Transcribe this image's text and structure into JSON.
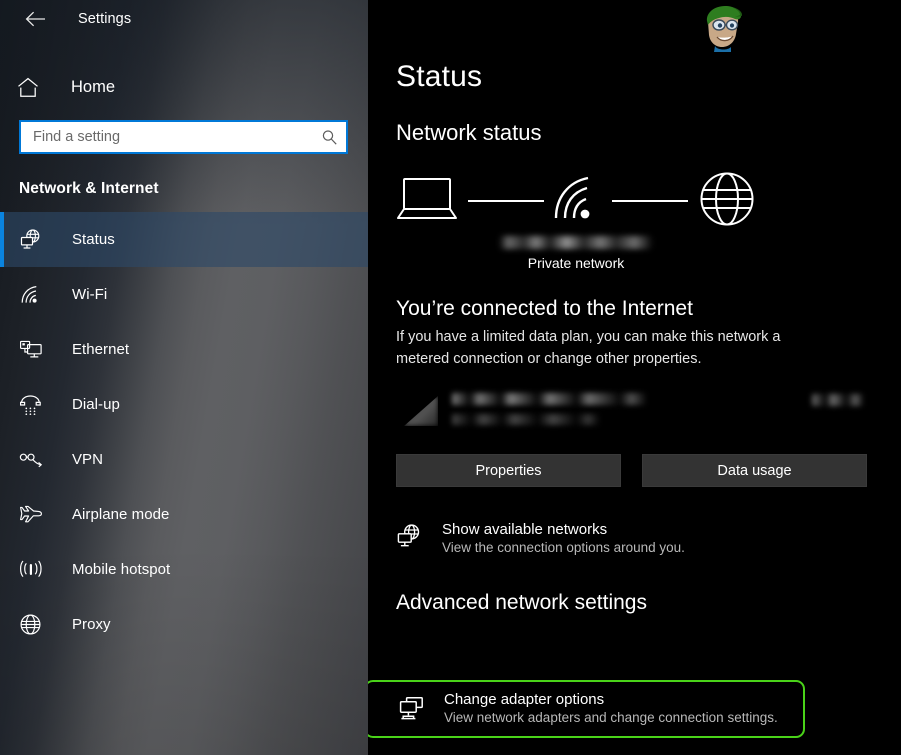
{
  "window": {
    "app_title": "Settings",
    "back_icon": "back-arrow-icon"
  },
  "sidebar": {
    "home": {
      "label": "Home",
      "icon": "home-icon"
    },
    "search": {
      "placeholder": "Find a setting",
      "value": "",
      "icon": "search-icon"
    },
    "category_heading": "Network & Internet",
    "items": [
      {
        "label": "Status",
        "icon": "network-status-icon",
        "selected": true
      },
      {
        "label": "Wi-Fi",
        "icon": "wifi-icon",
        "selected": false
      },
      {
        "label": "Ethernet",
        "icon": "ethernet-icon",
        "selected": false
      },
      {
        "label": "Dial-up",
        "icon": "dialup-phone-icon",
        "selected": false
      },
      {
        "label": "VPN",
        "icon": "vpn-icon",
        "selected": false
      },
      {
        "label": "Airplane mode",
        "icon": "airplane-icon",
        "selected": false
      },
      {
        "label": "Mobile hotspot",
        "icon": "mobile-hotspot-icon",
        "selected": false
      },
      {
        "label": "Proxy",
        "icon": "globe-proxy-icon",
        "selected": false
      }
    ],
    "accent_color": "#0a84e0",
    "selected_bg": "#2d4868"
  },
  "main": {
    "page_title": "Status",
    "network_status": {
      "section_title": "Network status",
      "diagram": {
        "device_icon": "laptop-icon",
        "link_icon": "wifi-signal-icon",
        "internet_icon": "globe-icon",
        "ssid_label": "",
        "ssid_redacted": true,
        "network_kind": "Private network"
      },
      "connected_heading": "You’re connected to the Internet",
      "connected_description": "If you have a limited data plan, you can make this network a metered connection or change other properties.",
      "usage_row": {
        "redacted": true,
        "network_name": "",
        "period_label": "",
        "data_size": ""
      },
      "buttons": [
        {
          "label": "Properties"
        },
        {
          "label": "Data usage"
        }
      ],
      "show_networks": {
        "icon": "network-status-icon",
        "title": "Show available networks",
        "subtitle": "View the connection options around you."
      }
    },
    "advanced": {
      "heading": "Advanced network settings",
      "change_adapter": {
        "icon": "adapter-options-icon",
        "title": "Change adapter options",
        "subtitle": "View network adapters and change connection settings.",
        "highlighted": true,
        "highlight_color": "#4ad319"
      }
    },
    "watermark": {
      "icon": "cartoon-avatar-watermark"
    }
  }
}
